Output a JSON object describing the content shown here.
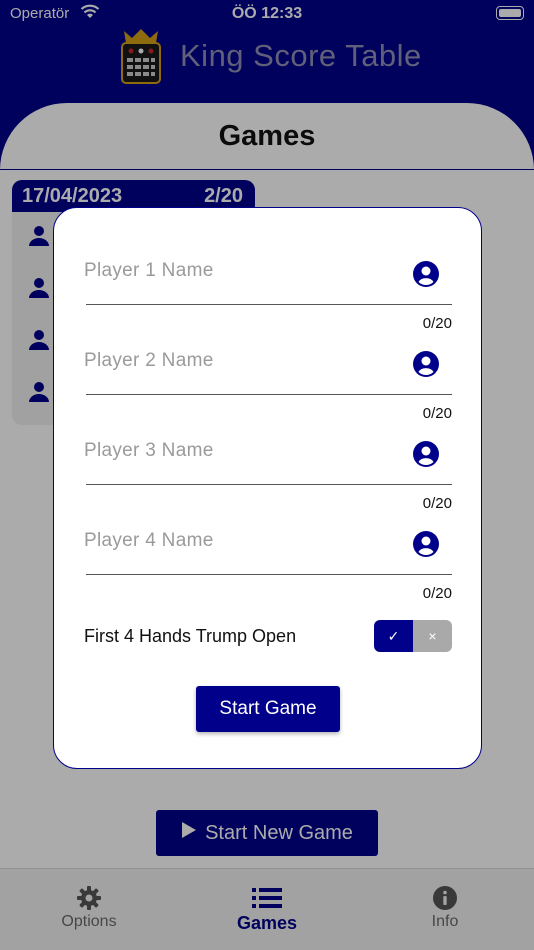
{
  "status": {
    "carrier": "Operatör",
    "time": "ÖÖ 12:33"
  },
  "app": {
    "title": "King Score Table"
  },
  "page": {
    "title": "Games"
  },
  "game_card": {
    "date": "17/04/2023",
    "progress": "2/20",
    "player_count": 4
  },
  "start_new_game": {
    "label": "Start New Game"
  },
  "modal": {
    "players": [
      {
        "placeholder": "Player 1 Name",
        "counter": "0/20"
      },
      {
        "placeholder": "Player 2 Name",
        "counter": "0/20"
      },
      {
        "placeholder": "Player 3 Name",
        "counter": "0/20"
      },
      {
        "placeholder": "Player 4 Name",
        "counter": "0/20"
      }
    ],
    "trump_open": {
      "label": "First 4 Hands Trump Open",
      "on_symbol": "✓",
      "off_symbol": "×",
      "value": true
    },
    "start_label": "Start Game"
  },
  "tabs": [
    {
      "label": "Options",
      "icon": "gear-icon",
      "active": false
    },
    {
      "label": "Games",
      "icon": "list-icon",
      "active": true
    },
    {
      "label": "Info",
      "icon": "info-icon",
      "active": false
    }
  ],
  "colors": {
    "primary": "#00008b",
    "muted_title": "#8f8fb8",
    "toggle_off": "#a9a9a9"
  }
}
